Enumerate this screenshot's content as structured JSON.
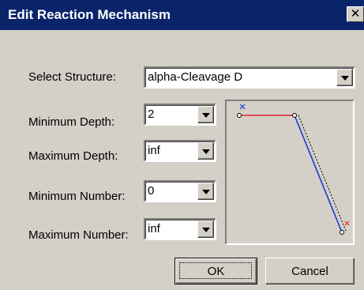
{
  "window": {
    "title": "Edit Reaction Mechanism",
    "close_glyph": "✕"
  },
  "form": {
    "select_structure": {
      "label": "Select Structure:",
      "value": "alpha-Cleavage D"
    },
    "min_depth": {
      "label": "Minimum Depth:",
      "value": "2"
    },
    "max_depth": {
      "label": "Maximum Depth:",
      "value": "inf"
    },
    "min_number": {
      "label": "Minimum Number:",
      "value": "0"
    },
    "max_number": {
      "label": "Maximum Number:",
      "value": "inf"
    }
  },
  "preview": {
    "bond_colors": {
      "horizontal": "#e02020",
      "diagonal": "#1a3ccf",
      "markers": "#ff2020",
      "start_marker": "#1a3ccf"
    }
  },
  "buttons": {
    "ok": "OK",
    "cancel": "Cancel"
  },
  "icons": {
    "dropdown": "chevron-down-icon",
    "close": "close-icon"
  }
}
